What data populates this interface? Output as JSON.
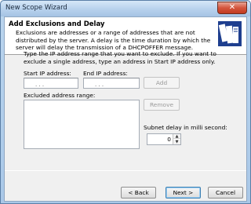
{
  "window": {
    "title": "New Scope Wizard",
    "close_glyph": "✕"
  },
  "header": {
    "title": "Add Exclusions and Delay",
    "description": "Exclusions are addresses or a range of addresses that are not distributed by the server. A delay is the time duration by which the server will delay the transmission of a DHCPOFFER message.",
    "icon": "wizard-books-icon"
  },
  "main": {
    "instructions": "Type the IP address range that you want to exclude. If you want to exclude a single address, type an address in Start IP address only.",
    "start_ip_label": "Start IP address:",
    "end_ip_label": "End IP address:",
    "start_ip_value": ".   .   .",
    "end_ip_value": ".   .   .",
    "add_button": "Add",
    "excluded_label": "Excluded address range:",
    "remove_button": "Remove",
    "subnet_delay_label": "Subnet delay in milli second:",
    "subnet_delay_value": "0"
  },
  "footer": {
    "back_button": "< Back",
    "next_button": "Next >",
    "cancel_button": "Cancel"
  }
}
